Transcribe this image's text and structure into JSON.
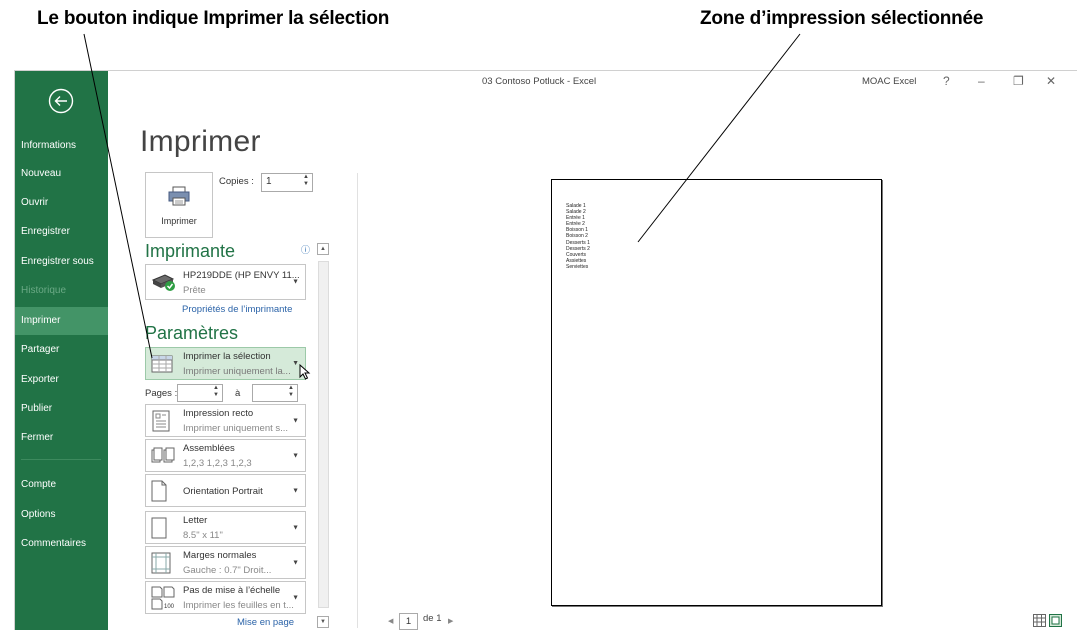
{
  "callouts": {
    "left": "Le bouton indique Imprimer la sélection",
    "right": "Zone d’impression sélectionnée"
  },
  "titlebar": {
    "title": "03 Contoso Potluck - Excel",
    "account": "MOAC Excel",
    "help": "?",
    "minimize": "–",
    "restore": "❐",
    "close": "✕"
  },
  "sidebar": {
    "items": [
      {
        "label": "Informations"
      },
      {
        "label": "Nouveau"
      },
      {
        "label": "Ouvrir"
      },
      {
        "label": "Enregistrer"
      },
      {
        "label": "Enregistrer sous"
      },
      {
        "label": "Historique"
      },
      {
        "label": "Imprimer"
      },
      {
        "label": "Partager"
      },
      {
        "label": "Exporter"
      },
      {
        "label": "Publier"
      },
      {
        "label": "Fermer"
      },
      {
        "label": "Compte"
      },
      {
        "label": "Options"
      },
      {
        "label": "Commentaires"
      }
    ],
    "active": "Imprimer",
    "disabled": "Historique"
  },
  "main": {
    "heading": "Imprimer",
    "print_button_label": "Imprimer",
    "copies_label": "Copies :",
    "copies_value": "1",
    "printer_section": "Imprimante",
    "printer_name": "HP219DDE (HP ENVY 11...",
    "printer_status": "Prête",
    "printer_properties_link": "Propriétés de l’imprimante",
    "settings_section": "Paramètres",
    "settings": {
      "what": {
        "title": "Imprimer la sélection",
        "sub": "Imprimer uniquement la..."
      },
      "pages_label": "Pages :",
      "pages_to": "à",
      "sides": {
        "title": "Impression recto",
        "sub": "Imprimer uniquement s..."
      },
      "collate": {
        "title": "Assemblées",
        "sub": "1,2,3   1,2,3   1,2,3"
      },
      "orientation": {
        "title": "Orientation Portrait"
      },
      "paper": {
        "title": "Letter",
        "sub": "8.5\" x 11\""
      },
      "margins": {
        "title": "Marges normales",
        "sub": "Gauche : 0.7\"      Droit..."
      },
      "scaling": {
        "title": "Pas de mise à l’échelle",
        "sub": "Imprimer les feuilles en t..."
      }
    },
    "page_setup_link": "Mise en page"
  },
  "preview": {
    "lines": [
      "Salade 1",
      "Salade 2",
      "Entrée 1",
      "Entrée 2",
      "Boisson 1",
      "Boisson 2",
      "Desserts 1",
      "Desserts 2",
      "Couverts",
      "Assiettes",
      "Serviettes"
    ],
    "current_page": "1",
    "page_of": "de 1"
  },
  "colors": {
    "sidebar": "#217346",
    "active_item": "#439467",
    "accent_green": "#217346",
    "link_blue": "#2b63a8",
    "selected_option": "#d5ead9"
  }
}
